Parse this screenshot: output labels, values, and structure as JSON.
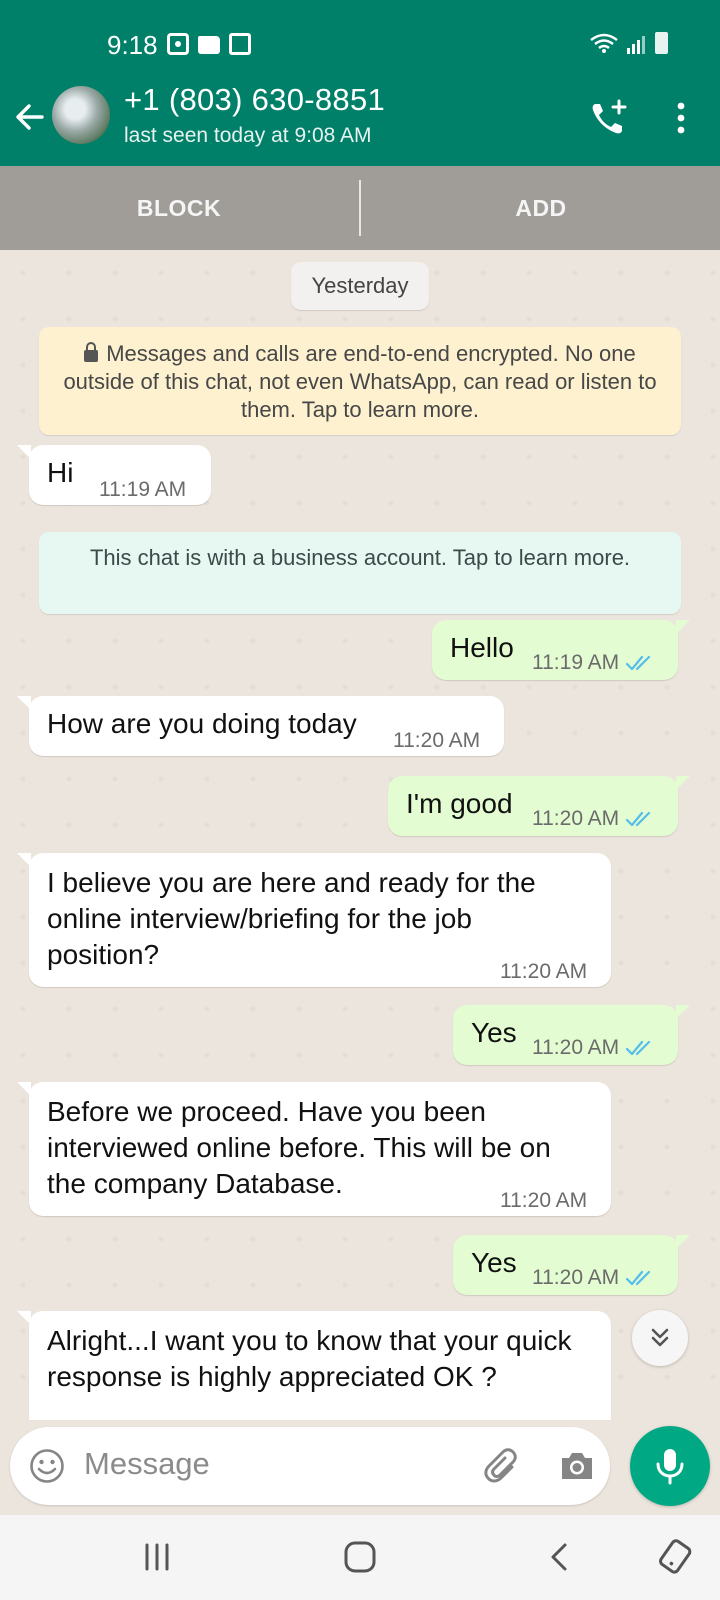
{
  "status_bar": {
    "time": "9:18"
  },
  "header": {
    "contact_name": "+1 (803) 630-8851",
    "last_seen": "last seen today at 9:08 AM"
  },
  "action_bar": {
    "block_label": "BLOCK",
    "add_label": "ADD"
  },
  "chat": {
    "date_chip": "Yesterday",
    "encryption_notice": "Messages and calls are end-to-end encrypted. No one outside of this chat, not even WhatsApp, can read or listen to them. Tap to learn more.",
    "business_notice": "This chat is with a business account. Tap to learn more.",
    "messages": [
      {
        "direction": "in",
        "text": "Hi",
        "time": "11:19 AM"
      },
      {
        "direction": "out",
        "text": "Hello",
        "time": "11:19 AM",
        "status": "read"
      },
      {
        "direction": "in",
        "text": "How are you doing today",
        "time": "11:20 AM"
      },
      {
        "direction": "out",
        "text": "I'm good",
        "time": "11:20 AM",
        "status": "read"
      },
      {
        "direction": "in",
        "text": "I believe you are here and ready for the online interview/briefing for the job position?",
        "time": "11:20 AM"
      },
      {
        "direction": "out",
        "text": "Yes",
        "time": "11:20 AM",
        "status": "read"
      },
      {
        "direction": "in",
        "text": "Before we proceed. Have you been interviewed online before. This will be on the company Database.",
        "time": "11:20 AM"
      },
      {
        "direction": "out",
        "text": "Yes",
        "time": "11:20 AM",
        "status": "read"
      },
      {
        "direction": "in",
        "text": "Alright...I want you to know that your quick response is highly appreciated OK ?",
        "time": ""
      }
    ]
  },
  "composer": {
    "placeholder": "Message"
  },
  "colors": {
    "header": "#008069",
    "accent": "#00a884",
    "outgoing_bubble": "#e3fcd2",
    "incoming_bubble": "#ffffff",
    "chat_background": "#ece5dd",
    "read_tick": "#53bdeb"
  },
  "icons": {
    "back": "arrow-left-icon",
    "call": "add-call-icon",
    "menu": "more-vertical-icon",
    "emoji": "emoji-icon",
    "attach": "paperclip-icon",
    "camera": "camera-icon",
    "mic": "microphone-icon",
    "scroll": "double-chevron-down-icon"
  }
}
